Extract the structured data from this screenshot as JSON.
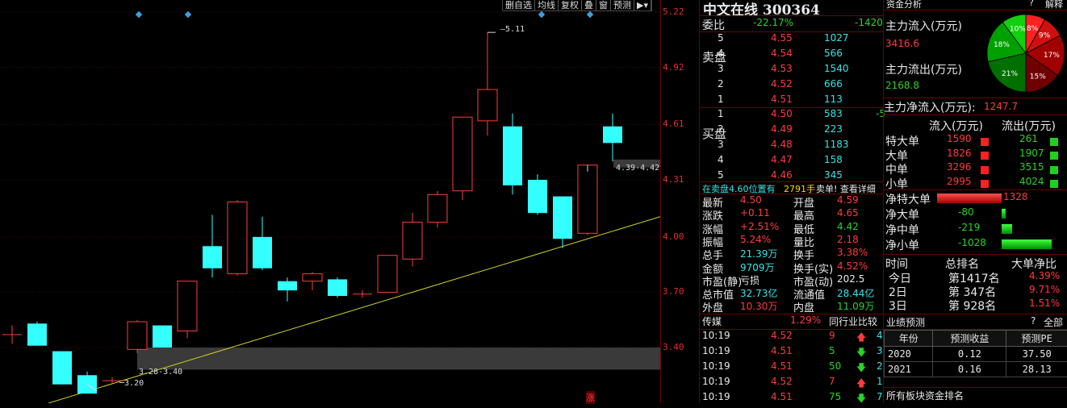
{
  "colors": {
    "up": "#ff3c3c",
    "down": "#33ffff",
    "trend": "#d0d020",
    "bg": "#000000"
  },
  "chart_data": {
    "type": "candlestick",
    "ylim": [
      3.1,
      5.25
    ],
    "y_ticks": [
      "5.22",
      "4.92",
      "4.61",
      "4.31",
      "4.00",
      "3.70",
      "3.40"
    ],
    "candles": [
      {
        "o": 3.47,
        "c": 3.47,
        "h": 3.52,
        "l": 3.42
      },
      {
        "o": 3.53,
        "c": 3.41,
        "h": 3.54,
        "l": 3.41
      },
      {
        "o": 3.38,
        "c": 3.2,
        "h": 3.38,
        "l": 3.2
      },
      {
        "o": 3.25,
        "c": 3.15,
        "h": 3.27,
        "l": 3.15
      },
      {
        "o": 3.22,
        "c": 3.22,
        "h": 3.24,
        "l": 3.2
      },
      {
        "o": 3.39,
        "c": 3.54,
        "h": 3.55,
        "l": 3.37
      },
      {
        "o": 3.52,
        "c": 3.4,
        "h": 3.52,
        "l": 3.4
      },
      {
        "o": 3.49,
        "c": 3.76,
        "h": 3.76,
        "l": 3.45
      },
      {
        "o": 3.95,
        "c": 3.83,
        "h": 4.12,
        "l": 3.78
      },
      {
        "o": 3.8,
        "c": 4.19,
        "h": 4.2,
        "l": 3.79
      },
      {
        "o": 4.0,
        "c": 3.83,
        "h": 4.11,
        "l": 3.82
      },
      {
        "o": 3.76,
        "c": 3.71,
        "h": 3.78,
        "l": 3.65
      },
      {
        "o": 3.76,
        "c": 3.8,
        "h": 3.81,
        "l": 3.71
      },
      {
        "o": 3.77,
        "c": 3.68,
        "h": 3.78,
        "l": 3.67
      },
      {
        "o": 3.69,
        "c": 3.69,
        "h": 3.71,
        "l": 3.67
      },
      {
        "o": 3.7,
        "c": 3.9,
        "h": 3.9,
        "l": 3.7
      },
      {
        "o": 3.88,
        "c": 4.08,
        "h": 4.13,
        "l": 3.84
      },
      {
        "o": 4.08,
        "c": 4.23,
        "h": 4.25,
        "l": 4.05
      },
      {
        "o": 4.25,
        "c": 4.65,
        "h": 4.65,
        "l": 4.2
      },
      {
        "o": 4.63,
        "c": 4.8,
        "h": 5.11,
        "l": 4.55
      },
      {
        "o": 4.6,
        "c": 4.28,
        "h": 4.67,
        "l": 4.23
      },
      {
        "o": 4.31,
        "c": 4.13,
        "h": 4.34,
        "l": 4.12
      },
      {
        "o": 4.22,
        "c": 3.99,
        "h": 4.22,
        "l": 3.94
      },
      {
        "o": 4.02,
        "c": 4.39,
        "h": 4.39,
        "l": 4.01
      },
      {
        "o": 4.6,
        "c": 4.51,
        "h": 4.67,
        "l": 4.41
      }
    ],
    "annotations": {
      "high": "5.11",
      "low": "3.20",
      "band_low": "3.28-3.40",
      "band_high": "4.39-4.42"
    }
  },
  "toolbar": [
    "删自选",
    "均线",
    "复权",
    "叠",
    "窗",
    "预测"
  ],
  "stock": {
    "title": "中文在线 300364"
  },
  "weibi": {
    "label": "委比",
    "pct": "-22.17%",
    "diff": "-1420"
  },
  "sell": {
    "label": "卖盘",
    "rows": [
      [
        "5",
        "4.55",
        "1027"
      ],
      [
        "4",
        "4.54",
        "566"
      ],
      [
        "3",
        "4.53",
        "1540"
      ],
      [
        "2",
        "4.52",
        "666"
      ],
      [
        "1",
        "4.51",
        "113"
      ]
    ]
  },
  "buy": {
    "label": "买盘",
    "rows": [
      [
        "1",
        "4.50",
        "583",
        "-5"
      ],
      [
        "2",
        "4.49",
        "223",
        ""
      ],
      [
        "3",
        "4.48",
        "1183",
        ""
      ],
      [
        "4",
        "4.47",
        "158",
        ""
      ],
      [
        "5",
        "4.46",
        "345",
        ""
      ]
    ]
  },
  "notice": {
    "left": "在卖盘4.60位置有",
    "mid": "2791手",
    "right": "卖单! 查看详细"
  },
  "stats": [
    [
      "最新",
      "4.50",
      "开盘",
      "4.59"
    ],
    [
      "涨跌",
      "+0.11",
      "最高",
      "4.65"
    ],
    [
      "涨幅",
      "+2.51%",
      "最低",
      "4.42"
    ],
    [
      "振幅",
      "5.24%",
      "量比",
      "2.18"
    ],
    [
      "总手",
      "21.39万",
      "换手",
      "3.38%"
    ],
    [
      "金额",
      "9709万",
      "换手(实)",
      "4.52%"
    ],
    [
      "市盈(静)",
      "亏损",
      "市盈(动)",
      "202.5"
    ],
    [
      "总市值",
      "32.73亿",
      "流通值",
      "28.44亿"
    ],
    [
      "外盘",
      "10.30万",
      "内盘",
      "11.09万"
    ]
  ],
  "sector": {
    "name": "传媒",
    "pct": "1.29%",
    "compare": "同行业比较"
  },
  "ticks": [
    [
      "10:19",
      "4.52",
      "9",
      "up",
      "4"
    ],
    [
      "10:19",
      "4.51",
      "5",
      "down",
      "3"
    ],
    [
      "10:19",
      "4.51",
      "50",
      "down",
      "2"
    ],
    [
      "10:19",
      "4.52",
      "7",
      "up",
      "1"
    ],
    [
      "10:19",
      "4.51",
      "75",
      "down",
      "7"
    ]
  ],
  "zhang": "涨",
  "flow": {
    "header": "资金分析",
    "header_btns": [
      "?",
      "解释"
    ],
    "inflow_label": "主力流入(万元)",
    "inflow": "3416.6",
    "outflow_label": "主力流出(万元)",
    "outflow": "2168.8",
    "net_label": "主力净流入(万元):",
    "net": "1247.7",
    "pie": [
      {
        "label": "8%",
        "value": 8,
        "color": "#ff2020"
      },
      {
        "label": "9%",
        "value": 9,
        "color": "#d01010"
      },
      {
        "label": "17%",
        "value": 17,
        "color": "#a00000"
      },
      {
        "label": "15%",
        "value": 15,
        "color": "#700000"
      },
      {
        "label": "21%",
        "value": 21,
        "color": "#007000"
      },
      {
        "label": "18%",
        "value": 18,
        "color": "#00a000"
      },
      {
        "label": "10%",
        "value": 10,
        "color": "#10d010"
      }
    ],
    "cols": [
      "流入(万元)",
      "流出(万元)"
    ],
    "rows": [
      [
        "特大单",
        "1590",
        "261"
      ],
      [
        "大单",
        "1826",
        "1907"
      ],
      [
        "中单",
        "3296",
        "3515"
      ],
      [
        "小单",
        "2995",
        "4024"
      ]
    ],
    "net_rows": [
      [
        "净特大单",
        "1328",
        1328
      ],
      [
        "净大单",
        "-80",
        -80
      ],
      [
        "净中单",
        "-219",
        -219
      ],
      [
        "净小单",
        "-1028",
        -1028
      ]
    ],
    "rank_head": [
      "时间",
      "总排名",
      "大单净比"
    ],
    "rank_rows": [
      [
        "今日",
        "第1417名",
        "4.39%"
      ],
      [
        "2日",
        "第 347名",
        "9.71%"
      ],
      [
        "3日",
        "第 928名",
        "1.51%"
      ]
    ],
    "perf_title": "业绩预测",
    "perf_btns": [
      "?",
      "全部"
    ],
    "perf_head": [
      "年份",
      "预测收益",
      "预测PE"
    ],
    "perf_rows": [
      [
        "2020",
        "0.12",
        "37.50"
      ],
      [
        "2021",
        "0.16",
        "28.13"
      ]
    ],
    "footer": "所有板块资金排名"
  }
}
